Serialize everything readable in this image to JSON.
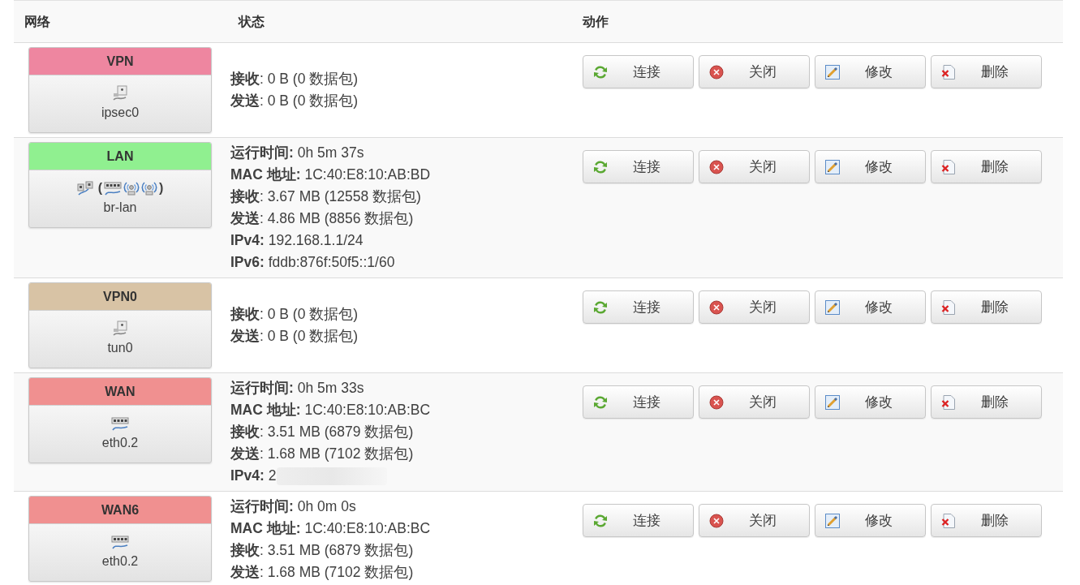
{
  "table": {
    "columns": [
      "网络",
      "状态",
      "动作"
    ],
    "rows": [
      {
        "network": "VPN",
        "color": "#ee86a0",
        "device": {
          "kind": "tunnel",
          "name": "ipsec0"
        },
        "status": [
          {
            "text": "**接收**: 0 B (0 数据包)",
            "redacted": false
          },
          {
            "text": "**发送**: 0 B (0 数据包)",
            "redacted": false
          }
        ],
        "actions": [
          {
            "kind": "connect",
            "label": "连接"
          },
          {
            "kind": "stop",
            "label": "关闭"
          },
          {
            "kind": "edit",
            "label": "修改"
          },
          {
            "kind": "delete",
            "label": "删除"
          }
        ]
      },
      {
        "network": "LAN",
        "color": "#90f090",
        "device": {
          "kind": "bridge",
          "name": "br-lan",
          "open": "(",
          "close": ")",
          "members": [
            {
              "kind": "switch"
            },
            {
              "kind": "wireless"
            },
            {
              "kind": "wireless"
            }
          ]
        },
        "status": [
          {
            "text": "**运行时间:** 0h 5m 37s",
            "redacted": false
          },
          {
            "text": "**MAC 地址:** 1C:40:E8:10:AB:BD",
            "redacted": false
          },
          {
            "text": "**接收**: 3.67 MB (12558 数据包)",
            "redacted": false
          },
          {
            "text": "**发送**: 4.86 MB (8856 数据包)",
            "redacted": false
          },
          {
            "text": "**IPv4:** 192.168.1.1/24",
            "redacted": false
          },
          {
            "text": "**IPv6:** fddb:876f:50f5::1/60",
            "redacted": false
          }
        ],
        "actions": [
          {
            "kind": "connect",
            "label": "连接"
          },
          {
            "kind": "stop",
            "label": "关闭"
          },
          {
            "kind": "edit",
            "label": "修改"
          },
          {
            "kind": "delete",
            "label": "删除"
          }
        ]
      },
      {
        "network": "VPN0",
        "color": "#d8c3a5",
        "device": {
          "kind": "tunnel",
          "name": "tun0"
        },
        "status": [
          {
            "text": "**接收**: 0 B (0 数据包)",
            "redacted": false
          },
          {
            "text": "**发送**: 0 B (0 数据包)",
            "redacted": false
          }
        ],
        "actions": [
          {
            "kind": "connect",
            "label": "连接"
          },
          {
            "kind": "stop",
            "label": "关闭"
          },
          {
            "kind": "edit",
            "label": "修改"
          },
          {
            "kind": "delete",
            "label": "删除"
          }
        ]
      },
      {
        "network": "WAN",
        "color": "#f09090",
        "device": {
          "kind": "switch",
          "name": "eth0.2"
        },
        "status": [
          {
            "text": "**运行时间:** 0h 5m 33s",
            "redacted": false
          },
          {
            "text": "**MAC 地址:** 1C:40:E8:10:AB:BC",
            "redacted": false
          },
          {
            "text": "**接收**: 3.51 MB (6879 数据包)",
            "redacted": false
          },
          {
            "text": "**发送**: 1.68 MB (7102 数据包)",
            "redacted": false
          },
          {
            "text": "**IPv4:** 2",
            "redacted": true
          }
        ],
        "actions": [
          {
            "kind": "connect",
            "label": "连接"
          },
          {
            "kind": "stop",
            "label": "关闭"
          },
          {
            "kind": "edit",
            "label": "修改"
          },
          {
            "kind": "delete",
            "label": "删除"
          }
        ]
      },
      {
        "network": "WAN6",
        "color": "#f09090",
        "device": {
          "kind": "switch",
          "name": "eth0.2"
        },
        "status": [
          {
            "text": "**运行时间:** 0h 0m 0s",
            "redacted": false
          },
          {
            "text": "**MAC 地址:** 1C:40:E8:10:AB:BC",
            "redacted": false
          },
          {
            "text": "**接收**: 3.51 MB (6879 数据包)",
            "redacted": false
          },
          {
            "text": "**发送**: 1.68 MB (7102 数据包)",
            "redacted": false
          }
        ],
        "actions": [
          {
            "kind": "connect",
            "label": "连接"
          },
          {
            "kind": "stop",
            "label": "关闭"
          },
          {
            "kind": "edit",
            "label": "修改"
          },
          {
            "kind": "delete",
            "label": "删除"
          }
        ]
      }
    ]
  }
}
